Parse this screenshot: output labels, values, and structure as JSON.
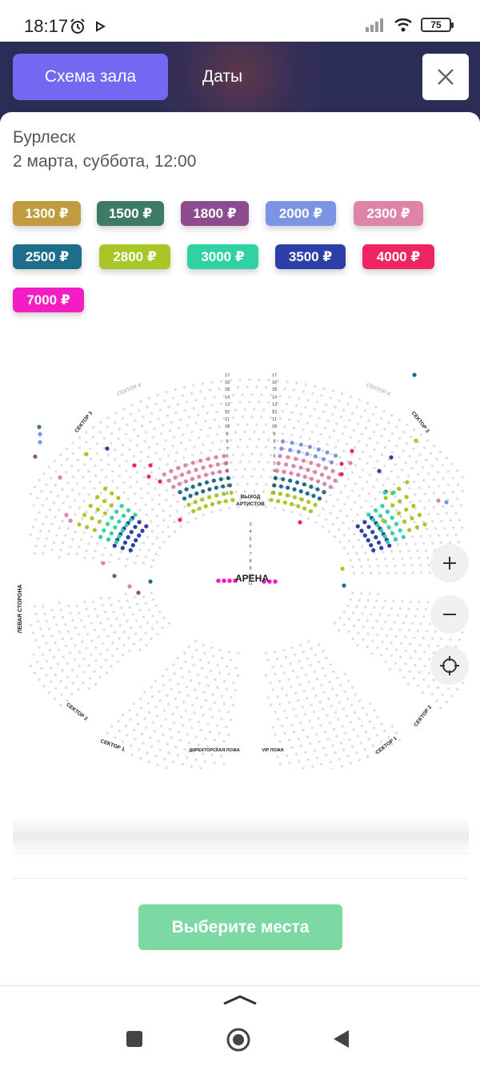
{
  "status_bar": {
    "time": "18:17",
    "battery": "75"
  },
  "tabs": {
    "schema": "Схема зала",
    "dates": "Даты"
  },
  "event": {
    "title": "Бурлеск",
    "date": "2 марта, суббота, 12:00"
  },
  "prices": [
    {
      "label": "1300 ₽",
      "color": "#c29a3f"
    },
    {
      "label": "1500 ₽",
      "color": "#3e7a66"
    },
    {
      "label": "1800 ₽",
      "color": "#8c4c8e"
    },
    {
      "label": "2000 ₽",
      "color": "#7d94e3"
    },
    {
      "label": "2300 ₽",
      "color": "#dd84a8"
    },
    {
      "label": "2500 ₽",
      "color": "#1e6d8a"
    },
    {
      "label": "2800 ₽",
      "color": "#a8c726"
    },
    {
      "label": "3000 ₽",
      "color": "#31d1a6"
    },
    {
      "label": "3500 ₽",
      "color": "#2c3ea8"
    },
    {
      "label": "4000 ₽",
      "color": "#ee2463"
    },
    {
      "label": "7000 ₽",
      "color": "#f21dc3"
    }
  ],
  "scheme": {
    "arena": "АРЕНА",
    "exit_line1": "ВЫХОД",
    "exit_line2": "АРТИСТОВ",
    "left_side": "ЛЕВАЯ СТОРОНА",
    "sector4_left": "СЕКТОР 4",
    "sector4_right": "СЕКТОР 4",
    "sector3_left": "СЕКТОР 3",
    "sector3_right": "СЕКТОР 3",
    "sector2_left": "СЕКТОР 2",
    "sector2_right": "СЕКТОР 2",
    "sector1_left": "СЕКТОР 1",
    "sector1_right": "СЕКТОР 1",
    "director_box": "ДИРЕКТОРСКАЯ ЛОЖА",
    "vip_box": "VIP ЛОЖА",
    "row_numbers_top": [
      "17",
      "16",
      "15",
      "14",
      "13",
      "12",
      "11",
      "10",
      "9",
      "8",
      "7",
      "6",
      "5",
      "4",
      "3",
      "2",
      "1"
    ],
    "row_numbers_bottom": [
      "3",
      "4",
      "5",
      "6",
      "7",
      "8",
      "9",
      "10",
      "11"
    ]
  },
  "actions": {
    "select_seats": "Выберите места"
  },
  "icons": {
    "close": "close-icon",
    "zoom_in": "plus-icon",
    "zoom_out": "minus-icon",
    "recenter": "crosshair-icon"
  }
}
